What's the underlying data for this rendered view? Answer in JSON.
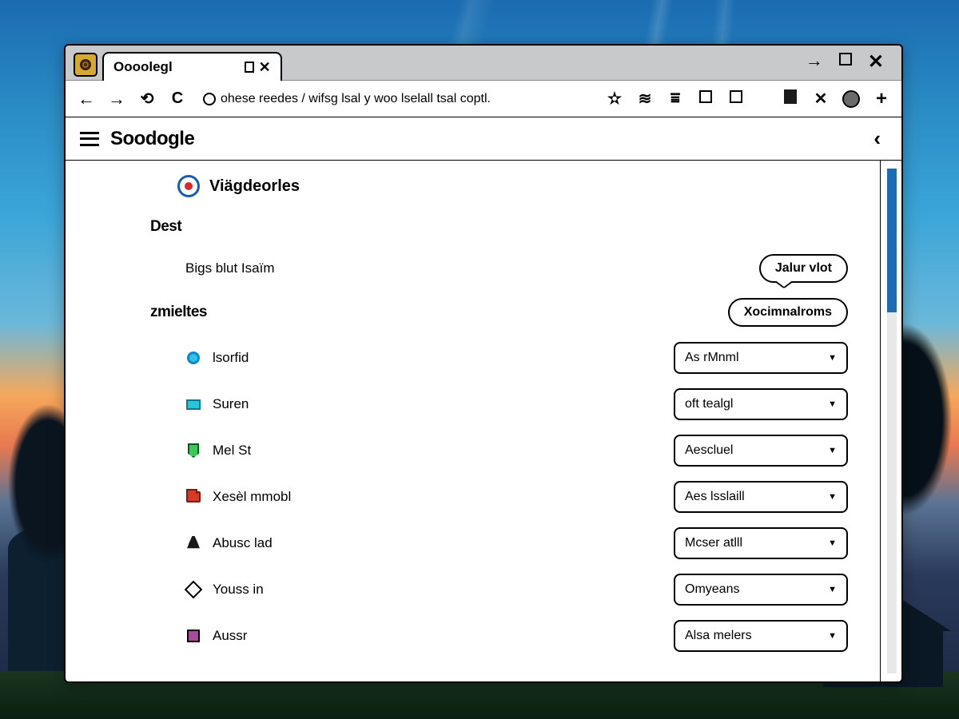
{
  "browser": {
    "tab_title": "Oooolegl",
    "url": "ohese reedes / wifsg lsal y woo lselall tsal coptl.",
    "window_controls": {
      "forward": "→",
      "restore": "▭",
      "close": "✕"
    }
  },
  "app": {
    "title": "Soodogle"
  },
  "page": {
    "heading": "Viägdeorles",
    "section1": {
      "label": "Dest",
      "row_label": "Bigs blut Isaïm",
      "button": "Jalur vlot"
    },
    "section2": {
      "label": "zmieltes",
      "header_button": "Xocimnalroms",
      "rows": [
        {
          "icon": "circle",
          "label": "lsorfid",
          "value": "As rMnml"
        },
        {
          "icon": "rect",
          "label": "Suren",
          "value": "oft tealgl"
        },
        {
          "icon": "shield",
          "label": "Mel St",
          "value": "Aescluel"
        },
        {
          "icon": "folder",
          "label": "Xesèl mmobl",
          "value": "Aes lsslaill"
        },
        {
          "icon": "bell",
          "label": "Abusc lad",
          "value": "Mcser atlll"
        },
        {
          "icon": "diamond",
          "label": "Youss in",
          "value": "Omyeans"
        },
        {
          "icon": "square",
          "label": "Aussr",
          "value": "Alsa melers"
        }
      ]
    }
  }
}
